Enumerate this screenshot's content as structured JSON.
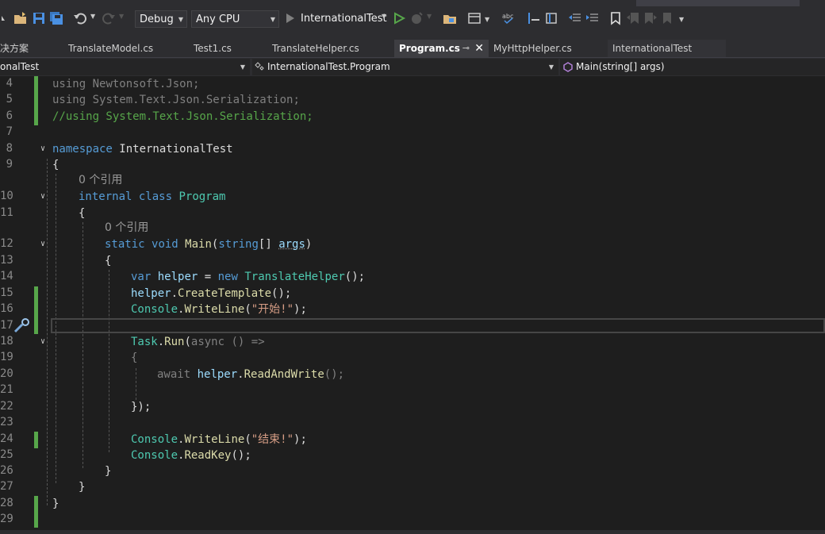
{
  "toolbar": {
    "config": "Debug",
    "platform": "Any CPU",
    "run_target": "InternationalTest"
  },
  "tabs": [
    {
      "label": "决方案"
    },
    {
      "label": "TranslateModel.cs"
    },
    {
      "label": "Test1.cs"
    },
    {
      "label": "TranslateHelper.cs"
    },
    {
      "label": "Program.cs",
      "active": true
    },
    {
      "label": "MyHttpHelper.cs"
    },
    {
      "label": "InternationalTest"
    }
  ],
  "nav": {
    "project": "onalTest",
    "class": "InternationalTest.Program",
    "member": "Main(string[] args)"
  },
  "code": {
    "line_numbers": [
      "4",
      "5",
      "6",
      "7",
      "8",
      "9",
      "10",
      "11",
      "12",
      "13",
      "14",
      "15",
      "16",
      "17",
      "18",
      "19",
      "20",
      "21",
      "22",
      "23",
      "24",
      "25",
      "26",
      "27",
      "28",
      "29"
    ],
    "l4_kw": "using",
    "l4_rest": " Newtonsoft.Json;",
    "l5_kw": "using",
    "l5_rest": " System.Text.Json.Serialization;",
    "l6_comment": "//using System.Text.Json.Serialization;",
    "l8_kw": "namespace",
    "l8_rest": " InternationalTest",
    "brace_open": "{",
    "brace_close": "}",
    "refs_hint": "0 个引用",
    "l10_kw1": "internal",
    "l10_kw2": "class",
    "l10_type": "Program",
    "l12_kw1": "static",
    "l12_kw2": "void",
    "l12_method": "Main",
    "l12_p1": "(",
    "l12_kw3": "string",
    "l12_p2": "[] ",
    "l12_arg": "args",
    "l12_p3": ")",
    "l14_kw": "var",
    "l14_var": "helper",
    "l14_eq": " = ",
    "l14_new": "new",
    "l14_type": "TranslateHelper",
    "l14_end": "();",
    "l15_var": "helper",
    "l15_dot": ".",
    "l15_method": "CreateTemplate",
    "l15_end": "();",
    "console": "Console",
    "dot": ".",
    "writeline": "WriteLine",
    "paren_open": "(",
    "paren_close": ");",
    "l16_str": "\"开始!\"",
    "l18_type": "Task",
    "l18_method": "Run",
    "l18_p": "(",
    "l18_kw": "async",
    "l18_rest": " () =>",
    "l20_kw": "await",
    "l20_var": "helper",
    "l20_method": "ReadAndWrite",
    "l20_end": "();",
    "l22": "});",
    "l24_str": "\"结束!\"",
    "l25_method": "ReadKey",
    "l25_end": "();"
  }
}
